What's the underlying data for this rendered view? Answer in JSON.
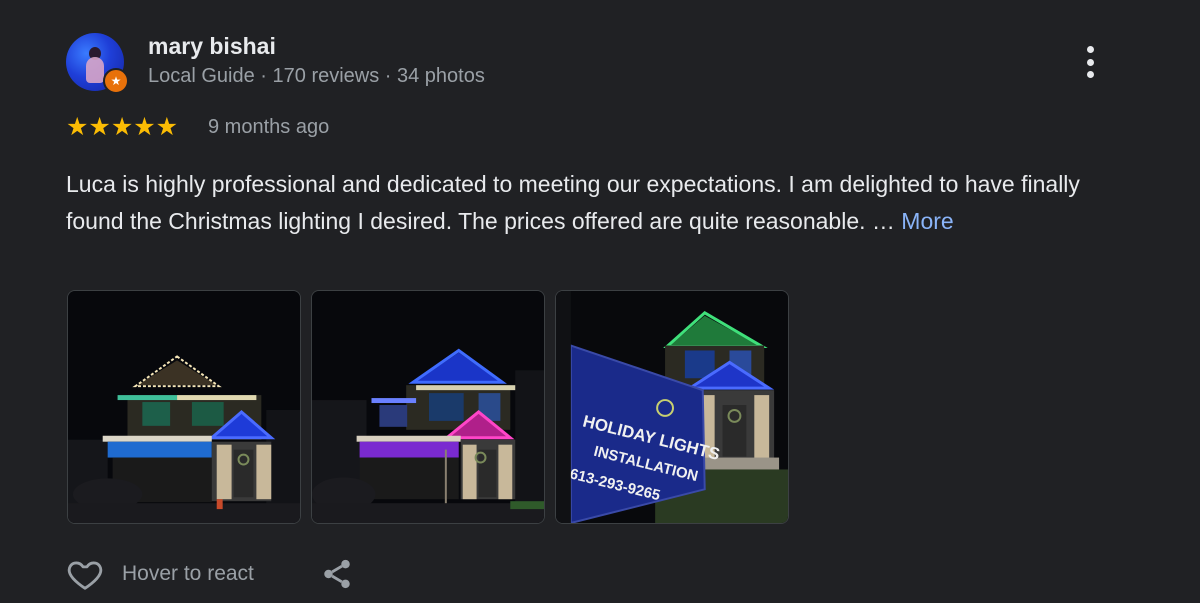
{
  "reviewer": {
    "name": "mary bishai",
    "meta": "Local Guide · 170 reviews · 34 photos",
    "avatar": "user-avatar",
    "badge_icon": "local-guide-star-icon"
  },
  "rating": {
    "stars": "★★★★★",
    "value": 5,
    "max": 5,
    "time_ago": "9 months ago",
    "star_color": "#fbbc04"
  },
  "review": {
    "text": "Luca is highly professional and dedicated to meeting our expectations. I am delighted to have finally found the Christmas lighting I desired. The prices offered are quite reasonable. …",
    "more_label": "More"
  },
  "photos": [
    {
      "name": "review-photo-1"
    },
    {
      "name": "review-photo-2"
    },
    {
      "name": "review-photo-3",
      "sign_text_1": "HOLIDAY LIGHTS",
      "sign_text_2": "INSTALLATION",
      "sign_text_3": "613-293-9265"
    }
  ],
  "actions": {
    "react_label": "Hover to react",
    "react_icon": "heart-icon",
    "share_icon": "share-icon",
    "menu_icon": "more-vert-icon"
  },
  "colors": {
    "background": "#202124",
    "text": "#e8eaed",
    "secondary_text": "#9aa0a6",
    "link": "#8ab4f8",
    "badge": "#e8710a"
  }
}
